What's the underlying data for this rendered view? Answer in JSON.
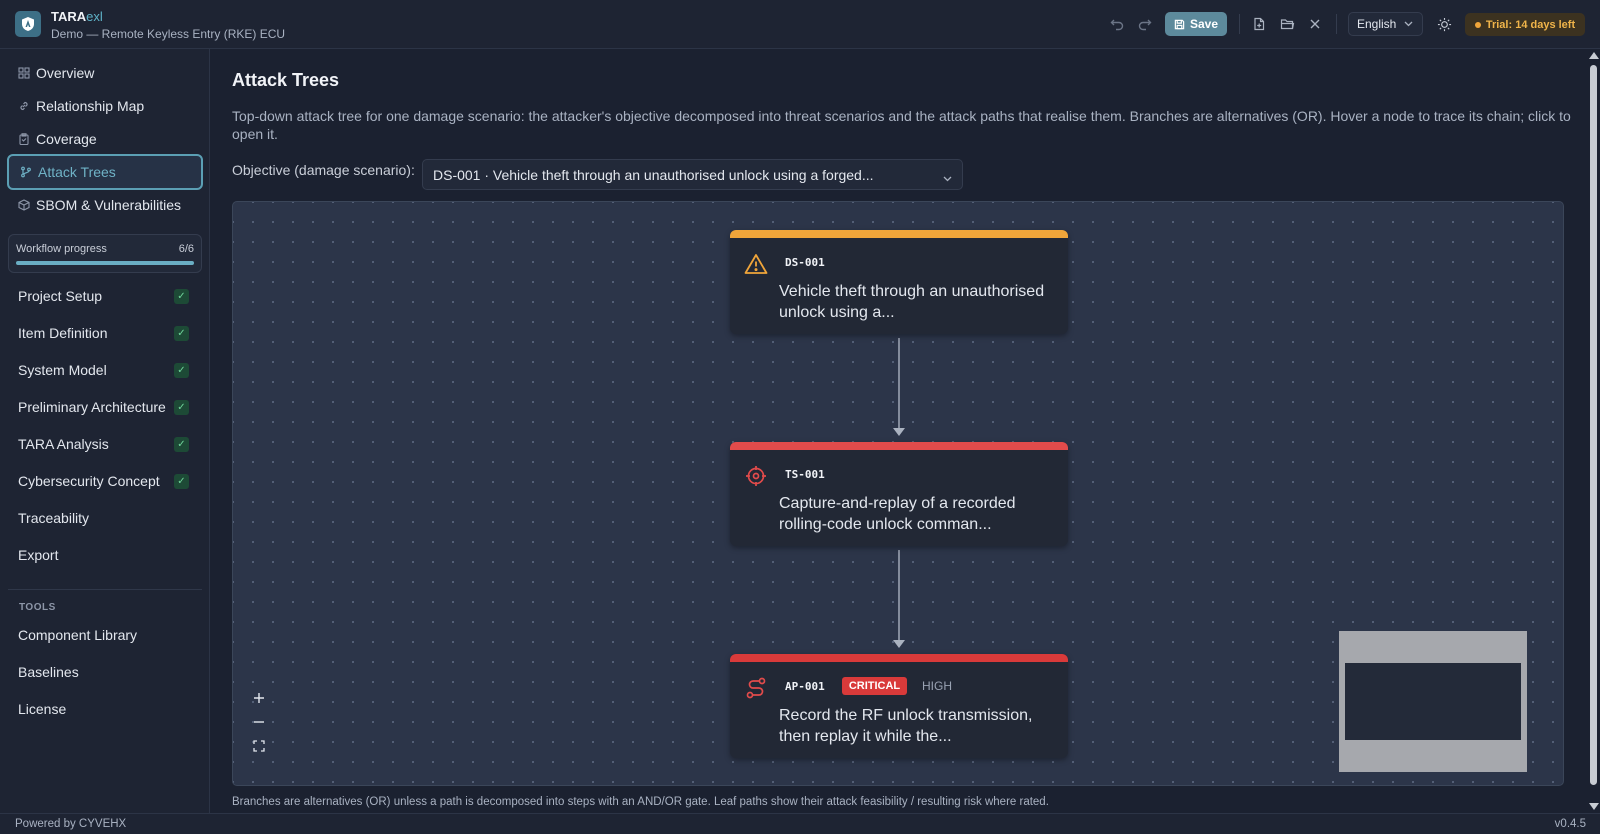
{
  "header": {
    "app_name_bold": "TARA",
    "app_name_accent": "exl",
    "project_name": "Demo — Remote Keyless Entry (RKE) ECU",
    "save_label": "Save",
    "language": "English",
    "trial_label": "Trial: 14 days left",
    "accent_color": "#5d8a9c",
    "trial_color": "#f0b44a"
  },
  "sidebar": {
    "nav": [
      {
        "label": "Overview",
        "icon": "grid-icon"
      },
      {
        "label": "Relationship Map",
        "icon": "link-icon"
      },
      {
        "label": "Coverage",
        "icon": "clipboard-icon"
      },
      {
        "label": "Attack Trees",
        "icon": "branch-icon",
        "active": true
      },
      {
        "label": "SBOM & Vulnerabilities",
        "icon": "package-icon"
      }
    ],
    "workflow": {
      "label": "Workflow progress",
      "count": "6/6",
      "progress": 1.0
    },
    "steps": [
      {
        "label": "Project Setup",
        "done": true
      },
      {
        "label": "Item Definition",
        "done": true
      },
      {
        "label": "System Model",
        "done": true
      },
      {
        "label": "Preliminary Architecture",
        "done": true
      },
      {
        "label": "TARA Analysis",
        "done": true
      },
      {
        "label": "Cybersecurity Concept",
        "done": true
      },
      {
        "label": "Traceability",
        "done": false
      },
      {
        "label": "Export",
        "done": false
      }
    ],
    "tools_heading": "TOOLS",
    "tools": [
      {
        "label": "Component Library"
      },
      {
        "label": "Baselines"
      },
      {
        "label": "License"
      }
    ],
    "check_mark": "✓"
  },
  "main": {
    "title": "Attack Trees",
    "description": "Top-down attack tree for one damage scenario: the attacker's objective decomposed into threat scenarios and the attack paths that realise them. Branches are alternatives (OR). Hover a node to trace its chain; click to open it.",
    "objective_label": "Objective (damage scenario):",
    "objective_value": "DS-001 · Vehicle theft through an unauthorised unlock using a forged...",
    "footnote": "Branches are alternatives (OR) unless a path is decomposed into steps with an AND/OR gate. Leaf paths show their attack feasibility / resulting risk where rated."
  },
  "tree": {
    "nodes": [
      {
        "id": "DS-001",
        "text": "Vehicle theft through an unauthorised unlock using a...",
        "kind": "damage-scenario",
        "color": "#f0a53a",
        "icon": "warning-icon"
      },
      {
        "id": "TS-001",
        "text": "Capture-and-replay of a recorded rolling-code unlock comman...",
        "kind": "threat-scenario",
        "color": "#e24b4b",
        "icon": "target-icon"
      },
      {
        "id": "AP-001",
        "text": "Record the RF unlock transmission, then replay it while the...",
        "kind": "attack-path",
        "color": "#d93a3a",
        "icon": "route-icon",
        "badge": "CRITICAL",
        "feasibility": "HIGH"
      }
    ]
  },
  "status": {
    "powered_by": "Powered by CYVEHX",
    "version": "v0.4.5"
  }
}
